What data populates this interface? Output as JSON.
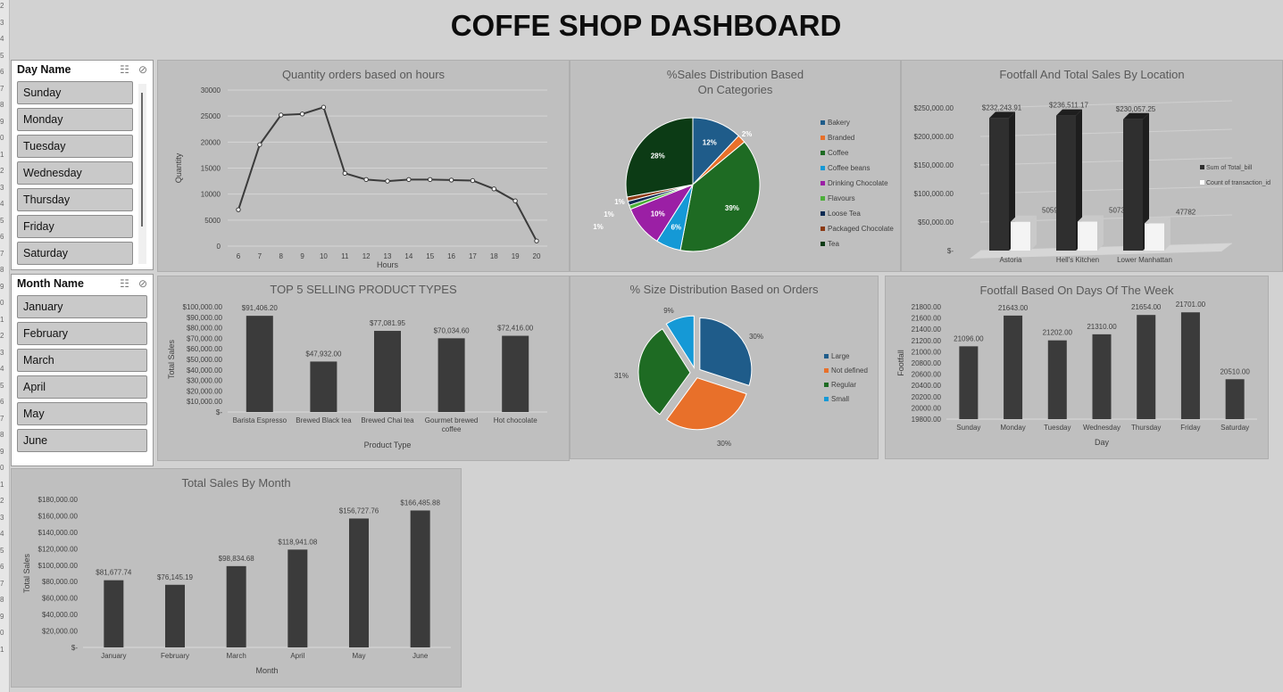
{
  "dashboard": {
    "title": "COFFE SHOP DASHBOARD"
  },
  "row_labels": [
    "2",
    "3",
    "4",
    "5",
    "6",
    "7",
    "8",
    "9",
    "0",
    "1",
    "2",
    "3",
    "4",
    "5",
    "6",
    "7",
    "8",
    "9",
    "0",
    "1",
    "2",
    "3",
    "4",
    "5",
    "6",
    "7",
    "8",
    "9",
    "0",
    "1",
    "2",
    "3",
    "4",
    "5",
    "6",
    "7",
    "8",
    "9",
    "0",
    "1"
  ],
  "slicers": {
    "day": {
      "header": "Day Name",
      "items": [
        "Sunday",
        "Monday",
        "Tuesday",
        "Wednesday",
        "Thursday",
        "Friday",
        "Saturday"
      ]
    },
    "month": {
      "header": "Month Name",
      "items": [
        "January",
        "February",
        "March",
        "April",
        "May",
        "June"
      ]
    }
  },
  "colors": {
    "bar": "#3b3b3b",
    "panel": "#bfbfbf",
    "pie": [
      "#1f5c8a",
      "#e8702a",
      "#1e6b23",
      "#1599d6",
      "#9b1fa5",
      "#4caf3a",
      "#0c2a52",
      "#8c3a14",
      "#0c3b15"
    ],
    "pie2": [
      "#1f5c8a",
      "#e8702a",
      "#1e6b23",
      "#1599d6"
    ]
  },
  "chart_data": [
    {
      "id": "hours",
      "type": "line",
      "title": "Quantity orders based on hours",
      "xlabel": "Hours",
      "ylabel": "Quantity",
      "x": [
        6,
        7,
        8,
        9,
        10,
        11,
        12,
        13,
        14,
        15,
        16,
        17,
        18,
        19,
        20
      ],
      "values": [
        7000,
        19500,
        25200,
        25400,
        26700,
        14000,
        12800,
        12500,
        12800,
        12800,
        12700,
        12600,
        11000,
        8700,
        1000
      ],
      "ylim": [
        0,
        30000
      ],
      "yticks": [
        "0",
        "5000",
        "10000",
        "15000",
        "20000",
        "25000",
        "30000"
      ],
      "grid": true
    },
    {
      "id": "categories",
      "type": "pie",
      "title": "%Sales  Distribution Based On Categories",
      "title_lines": [
        "%Sales  Distribution Based",
        "On Categories"
      ],
      "categories": [
        "Bakery",
        "Branded",
        "Coffee",
        "Coffee beans",
        "Drinking Chocolate",
        "Flavours",
        "Loose Tea",
        "Packaged Chocolate",
        "Tea"
      ],
      "values": [
        12,
        2,
        39,
        6,
        10,
        1,
        1,
        1,
        28
      ],
      "labels": [
        "12%",
        "2%",
        "39%",
        "6%",
        "10%",
        "1%",
        "1%",
        "1%",
        "28%"
      ],
      "legend": "right"
    },
    {
      "id": "location",
      "type": "bar",
      "title": "Footfall And Total Sales  By Location",
      "categories": [
        "Astoria",
        "Hell's Kitchen",
        "Lower Manhattan"
      ],
      "series": [
        {
          "name": "Sum of Total_bill",
          "values": [
            232243.91,
            236511.17,
            230057.25
          ],
          "labels": [
            "$232,243.91",
            "$236,511.17",
            "$230,057.25"
          ]
        },
        {
          "name": "Count of transaction_id",
          "values": [
            50599,
            50735,
            47782
          ],
          "labels": [
            "50599",
            "50735",
            "47782"
          ]
        }
      ],
      "ylim": [
        0,
        250000
      ],
      "yticks": [
        "$-",
        "$50,000.00",
        "$100,000.00",
        "$150,000.00",
        "$200,000.00",
        "$250,000.00"
      ],
      "legend": "right"
    },
    {
      "id": "top5",
      "type": "bar",
      "title": "TOP 5 SELLING PRODUCT TYPES",
      "xlabel": "Product Type",
      "ylabel": "Total Sales",
      "categories": [
        "Barista Espresso",
        "Brewed Black tea",
        "Brewed Chai tea",
        "Gourmet brewed coffee",
        "Hot chocolate"
      ],
      "category_lines": [
        [
          "Barista Espresso"
        ],
        [
          "Brewed Black tea"
        ],
        [
          "Brewed Chai tea"
        ],
        [
          "Gourmet brewed",
          "coffee"
        ],
        [
          "Hot chocolate"
        ]
      ],
      "values": [
        91406.2,
        47932.0,
        77081.95,
        70034.6,
        72416.0
      ],
      "labels": [
        "$91,406.20",
        "$47,932.00",
        "$77,081.95",
        "$70,034.60",
        "$72,416.00"
      ],
      "ylim": [
        0,
        100000
      ],
      "yticks": [
        "$-",
        "$10,000.00",
        "$20,000.00",
        "$30,000.00",
        "$40,000.00",
        "$50,000.00",
        "$60,000.00",
        "$70,000.00",
        "$80,000.00",
        "$90,000.00",
        "$100,000.00"
      ]
    },
    {
      "id": "size",
      "type": "pie",
      "title": "% Size Distribution Based on Orders",
      "categories": [
        "Large",
        "Not defined",
        "Regular",
        "Small"
      ],
      "values": [
        30,
        30,
        31,
        9
      ],
      "labels": [
        "30%",
        "30%",
        "31%",
        "9%"
      ],
      "legend": "right"
    },
    {
      "id": "days",
      "type": "bar",
      "title": "Footfall  Based On Days Of The Week",
      "xlabel": "Day",
      "ylabel": "Footfall",
      "categories": [
        "Sunday",
        "Monday",
        "Tuesday",
        "Wednesday",
        "Thursday",
        "Friday",
        "Saturday"
      ],
      "values": [
        21096.0,
        21643.0,
        21202.0,
        21310.0,
        21654.0,
        21701.0,
        20510.0
      ],
      "labels": [
        "21096.00",
        "21643.00",
        "21202.00",
        "21310.00",
        "21654.00",
        "21701.00",
        "20510.00"
      ],
      "ylim": [
        19800,
        21800
      ],
      "yticks": [
        "19800.00",
        "20000.00",
        "20200.00",
        "20400.00",
        "20600.00",
        "20800.00",
        "21000.00",
        "21200.00",
        "21400.00",
        "21600.00",
        "21800.00"
      ]
    },
    {
      "id": "month",
      "type": "bar",
      "title": "Total Sales By Month",
      "xlabel": "Month",
      "ylabel": "Total Sales",
      "categories": [
        "January",
        "February",
        "March",
        "April",
        "May",
        "June"
      ],
      "values": [
        81677.74,
        76145.19,
        98834.68,
        118941.08,
        156727.76,
        166485.88
      ],
      "labels": [
        "$81,677.74",
        "$76,145.19",
        "$98,834.68",
        "$118,941.08",
        "$156,727.76",
        "$166,485.88"
      ],
      "ylim": [
        0,
        180000
      ],
      "yticks": [
        "$-",
        "$20,000.00",
        "$40,000.00",
        "$60,000.00",
        "$80,000.00",
        "$100,000.00",
        "$120,000.00",
        "$140,000.00",
        "$160,000.00",
        "$180,000.00"
      ]
    }
  ]
}
